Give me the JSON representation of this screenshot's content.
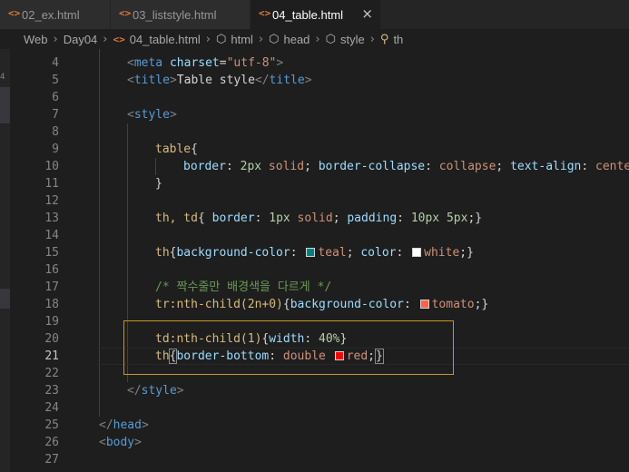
{
  "tabs": [
    {
      "icon": "html-file-icon",
      "icon_glyph": "<>",
      "label": "02_ex.html",
      "active": false
    },
    {
      "icon": "html-file-icon",
      "icon_glyph": "<>",
      "label": "03_liststyle.html",
      "active": false
    },
    {
      "icon": "html-file-icon",
      "icon_glyph": "<>",
      "label": "04_table.html",
      "active": true,
      "close": "×"
    }
  ],
  "breadcrumb": [
    "Web",
    "Day04",
    "04_table.html",
    "html",
    "head",
    "style",
    "th"
  ],
  "breadcrumb_separator": "›",
  "line_numbers": [
    "4",
    "5",
    "6",
    "7",
    "8",
    "9",
    "10",
    "11",
    "12",
    "13",
    "14",
    "15",
    "16",
    "17",
    "18",
    "19",
    "20",
    "21",
    "22",
    "23",
    "24",
    "25",
    "26",
    "27"
  ],
  "activity_gutter_number": "4",
  "colors": {
    "teal_swatch": "#008080",
    "white_swatch": "#ffffff",
    "tomato_swatch": "#ff6347",
    "red_swatch": "#ff0000",
    "selection_border": "#c7961e",
    "html_icon": "#e37933"
  },
  "code": {
    "l4_tag_open": "<",
    "l4_tag": "meta",
    "l4_attr": "charset",
    "l4_eq": "=",
    "l4_val": "\"utf-8\"",
    "l4_close": ">",
    "l5_open": "<",
    "l5_tag": "title",
    "l5_close": ">",
    "l5_text": "Table style",
    "l5_end_open": "</",
    "l5_end_tag": "title",
    "l5_end_close": ">",
    "l7_open": "<",
    "l7_tag": "style",
    "l7_close": ">",
    "l9_sel": "table",
    "l9_brace": "{",
    "l10_prop1": "border",
    "l10_colon1": ": ",
    "l10_num1": "2px",
    "l10_val1": " solid",
    "l10_semi1": "; ",
    "l10_prop2": "border-collapse",
    "l10_colon2": ": ",
    "l10_val2": "collapse",
    "l10_semi2": "; ",
    "l10_prop3": "text-align",
    "l10_colon3": ": ",
    "l10_val3": "center",
    "l11_brace": "}",
    "l13_sel": "th, td",
    "l13_brace_open": "{ ",
    "l13_prop1": "border",
    "l13_colon1": ": ",
    "l13_num1": "1px",
    "l13_val1": " solid",
    "l13_semi1": "; ",
    "l13_prop2": "padding",
    "l13_colon2": ": ",
    "l13_num2": "10px",
    "l13_num3": " 5px",
    "l13_end": ";}",
    "l15_sel": "th",
    "l15_brace": "{",
    "l15_prop1": "background-color",
    "l15_colon1": ": ",
    "l15_val1": "teal",
    "l15_semi1": "; ",
    "l15_prop2": "color",
    "l15_colon2": ": ",
    "l15_val2": "white",
    "l15_end": ";}",
    "l17_comment": "/* 짝수줄만 배경색을 다르게 */",
    "l18_sel": "tr:nth-child(2n+0)",
    "l18_brace": "{",
    "l18_prop": "background-color",
    "l18_colon": ": ",
    "l18_val": "tomato",
    "l18_end": ";}",
    "l20_sel": "td:nth-child(1)",
    "l20_brace": "{",
    "l20_prop": "width",
    "l20_colon": ": ",
    "l20_num": "40%",
    "l20_end": "}",
    "l21_sel": "th",
    "l21_brace": "{",
    "l21_prop": "border-bottom",
    "l21_colon": ": ",
    "l21_val1": "double ",
    "l21_val2": "red",
    "l21_semi": ";",
    "l21_end": "}",
    "l23_open": "</",
    "l23_tag": "style",
    "l23_close": ">",
    "l25_open": "</",
    "l25_tag": "head",
    "l25_close": ">",
    "l26_open": "<",
    "l26_tag": "body",
    "l26_close": ">"
  }
}
